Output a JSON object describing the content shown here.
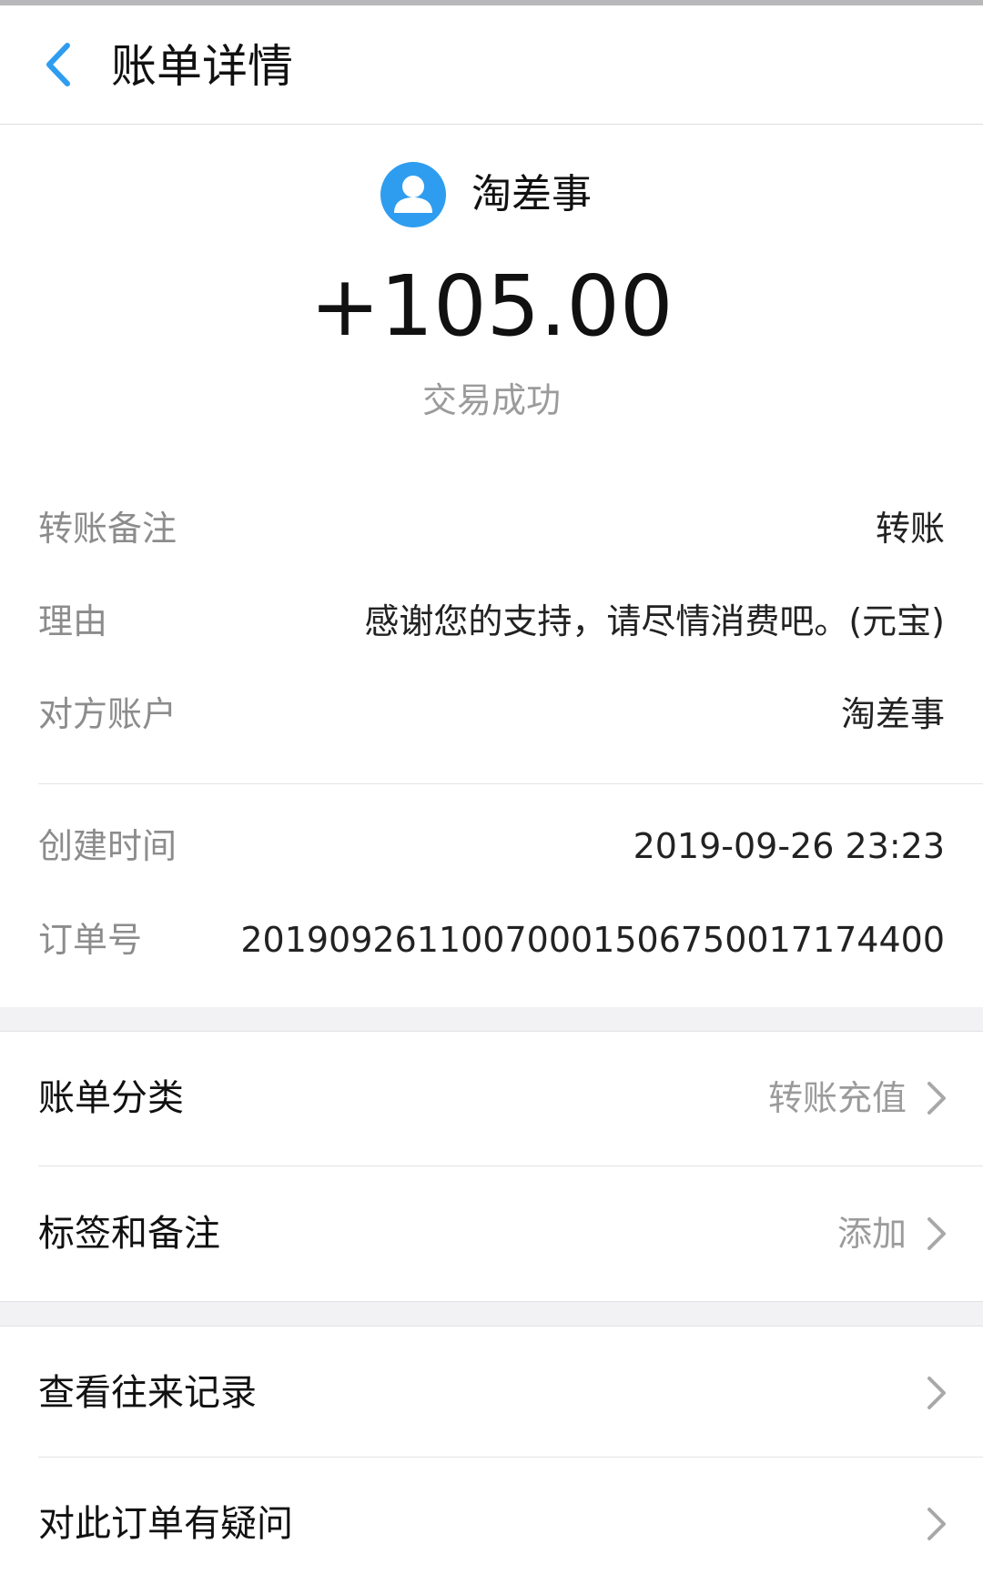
{
  "header": {
    "title": "账单详情",
    "back_icon": "chevron-left-icon",
    "accent_color": "#2e9df0"
  },
  "summary": {
    "payee_name": "淘差事",
    "avatar_icon": "user-avatar-icon",
    "amount": "+105.00",
    "status": "交易成功"
  },
  "details": [
    {
      "label": "转账备注",
      "value": "转账"
    },
    {
      "label": "理由",
      "value": "感谢您的支持，请尽情消费吧。(元宝)"
    },
    {
      "label": "对方账户",
      "value": "淘差事"
    },
    {
      "label": "创建时间",
      "value": "2019-09-26 23:23"
    },
    {
      "label": "订单号",
      "value": "20190926110070001506750017174400"
    }
  ],
  "menu_section_1": [
    {
      "label": "账单分类",
      "value": "转账充值"
    },
    {
      "label": "标签和备注",
      "value": "添加"
    }
  ],
  "menu_section_2": [
    {
      "label": "查看往来记录"
    },
    {
      "label": "对此订单有疑问"
    }
  ]
}
